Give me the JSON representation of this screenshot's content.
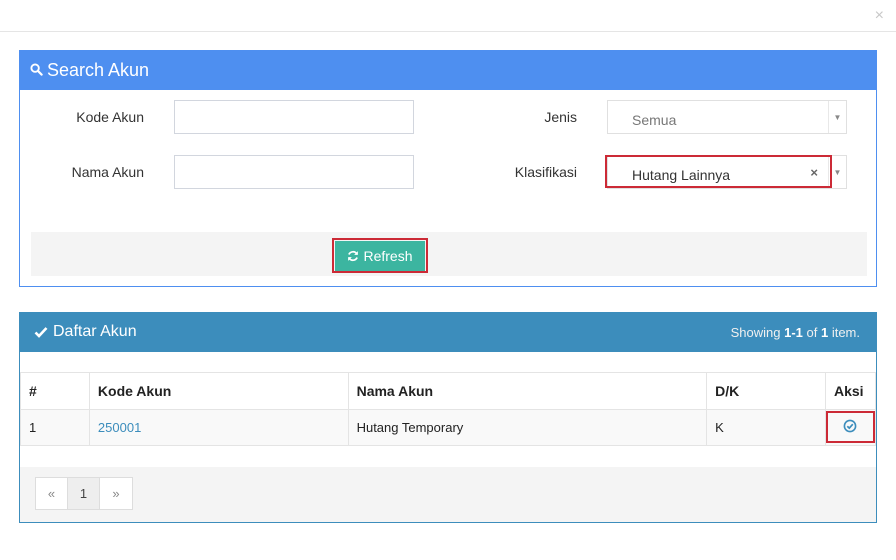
{
  "modal": {
    "close_glyph": "×"
  },
  "search_panel": {
    "title": "Search Akun",
    "icon": "search-icon",
    "kode_akun_label": "Kode Akun",
    "kode_akun_value": "",
    "nama_akun_label": "Nama Akun",
    "nama_akun_value": "",
    "jenis_label": "Jenis",
    "jenis_value": "Semua",
    "klasifikasi_label": "Klasifikasi",
    "klasifikasi_value": "Hutang Lainnya",
    "clear_glyph": "×",
    "arrow_glyph": "▼",
    "refresh_label": "Refresh",
    "refresh_icon": "refresh-icon"
  },
  "list_panel": {
    "title": "Daftar Akun",
    "icon": "check-icon",
    "summary_prefix": "Showing ",
    "summary_range": "1-1",
    "summary_mid": " of ",
    "summary_total": "1",
    "summary_suffix": " item.",
    "columns": [
      "#",
      "Kode Akun",
      "Nama Akun",
      "D/K",
      "Aksi"
    ],
    "rows": [
      {
        "no": "1",
        "kode": "250001",
        "nama": "Hutang Temporary",
        "dk": "K",
        "action_icon": "select-check-icon"
      }
    ],
    "pagination": {
      "prev": "«",
      "page": "1",
      "next": "»"
    }
  },
  "colors": {
    "search_header": "#4e8ff0",
    "list_header": "#3c8dbc",
    "refresh_button": "#3cb5a0",
    "highlight": "#cc2a36"
  }
}
